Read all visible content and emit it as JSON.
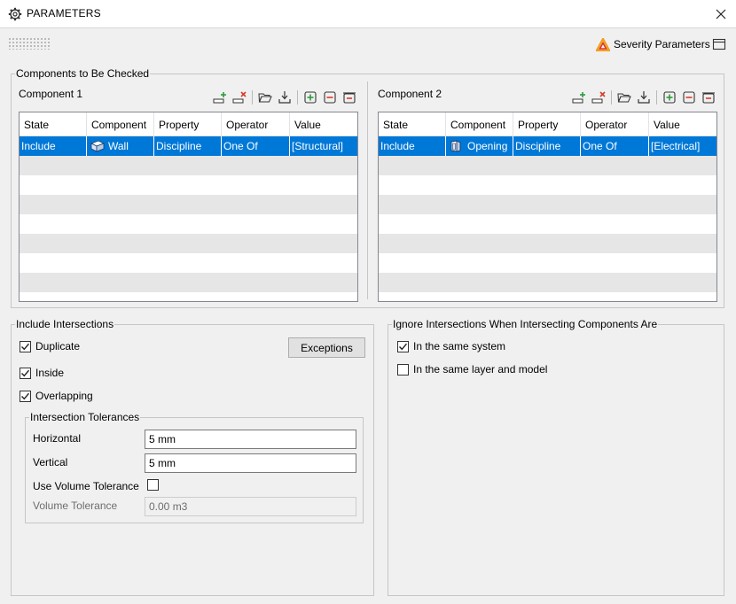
{
  "window": {
    "title": "PARAMETERS",
    "close_label": "✕"
  },
  "header": {
    "severity_label": "Severity Parameters"
  },
  "components": {
    "legend": "Components to Be Checked",
    "columns": [
      "State",
      "Component",
      "Property",
      "Operator",
      "Value"
    ],
    "component1": {
      "label": "Component 1",
      "rows": [
        {
          "state": "Include",
          "component": "Wall",
          "property": "Discipline",
          "operator": "One Of",
          "value": "[Structural]"
        }
      ]
    },
    "component2": {
      "label": "Component 2",
      "rows": [
        {
          "state": "Include",
          "component": "Opening",
          "property": "Discipline",
          "operator": "One Of",
          "value": "[Electrical]"
        }
      ]
    }
  },
  "include": {
    "legend": "Include Intersections",
    "duplicate": {
      "label": "Duplicate",
      "checked": true
    },
    "inside": {
      "label": "Inside",
      "checked": true
    },
    "overlapping": {
      "label": "Overlapping",
      "checked": true
    },
    "exceptions_label": "Exceptions",
    "tolerances": {
      "legend": "Intersection Tolerances",
      "horizontal_label": "Horizontal",
      "horizontal_value": "5 mm",
      "vertical_label": "Vertical",
      "vertical_value": "5 mm",
      "use_volume_label": "Use Volume Tolerance",
      "use_volume_checked": false,
      "volume_label": "Volume Tolerance",
      "volume_value": "0.00 m3"
    }
  },
  "ignore": {
    "legend": "Ignore Intersections When Intersecting Components Are",
    "same_system": {
      "label": "In the same system",
      "checked": true
    },
    "same_layer": {
      "label": "In the same layer and model",
      "checked": false
    }
  },
  "colors": {
    "selection": "#0078d7",
    "alt_row": "#e6e6e6",
    "add": "#2e9b3a",
    "remove": "#d93a2b"
  }
}
